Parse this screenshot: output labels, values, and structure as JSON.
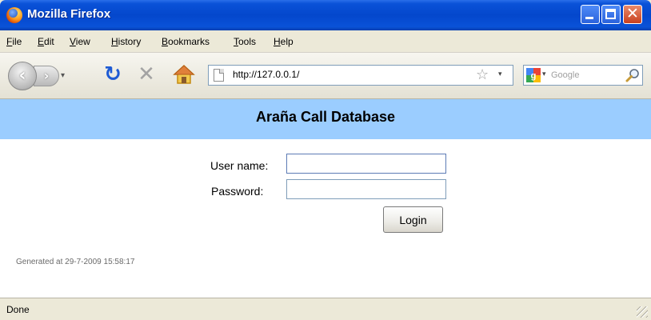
{
  "window": {
    "title": "Mozilla Firefox"
  },
  "menu": {
    "items": [
      {
        "label": "File"
      },
      {
        "label": "Edit"
      },
      {
        "label": "View"
      },
      {
        "label": "History"
      },
      {
        "label": "Bookmarks"
      },
      {
        "label": "Tools"
      },
      {
        "label": "Help"
      }
    ]
  },
  "navbar": {
    "url": "http://127.0.0.1/",
    "search_placeholder": "Google",
    "icons": {
      "back": "back-arrow-icon",
      "forward": "forward-arrow-icon",
      "reload": "reload-icon",
      "stop": "stop-icon",
      "home": "home-icon",
      "bookmark": "star-icon",
      "search_engine": "google-logo-icon",
      "search": "magnifier-icon"
    }
  },
  "page": {
    "header_title": "Araña Call Database",
    "header_color": "#9bcdff",
    "form": {
      "username_label": "User name:",
      "username_value": "",
      "password_label": "Password:",
      "password_value": "",
      "login_label": "Login"
    },
    "generated": "Generated at 29-7-2009 15:58:17"
  },
  "status": {
    "text": "Done"
  }
}
